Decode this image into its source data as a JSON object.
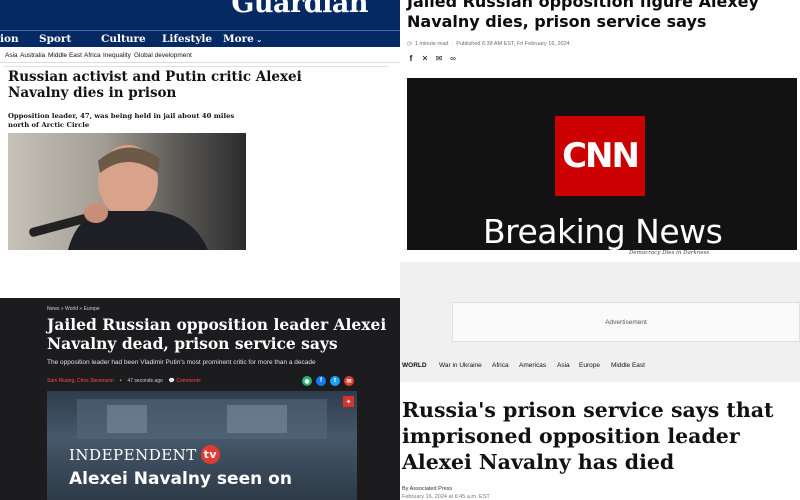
{
  "guardian": {
    "logo": "Guardian",
    "nav": [
      "ion",
      "Sport",
      "Culture",
      "Lifestyle",
      "More"
    ],
    "subnav": [
      "Asia",
      "Australia",
      "Middle East",
      "Africa",
      "Inequality",
      "Global development"
    ],
    "headline": "Russian activist and Putin critic Alexei Navalny dies in prison",
    "standfirst": "Opposition leader, 47, was being held in jail about 40 miles north of Arctic Circle",
    "colors": {
      "brand": "#052962"
    }
  },
  "cnn": {
    "headline": "Jailed Russian opposition figure Alexey Navalny dies, prison service says",
    "read_time": "1 minute read",
    "published": "Published 6:39 AM EST, Fri February 16, 2024",
    "share_icons": [
      "facebook-icon",
      "x-icon",
      "email-icon",
      "link-icon"
    ],
    "logo": "CNN",
    "breaking": "Breaking News",
    "tagline": "Democracy Dies in Darkness",
    "colors": {
      "brand": "#cc0000"
    }
  },
  "independent": {
    "breadcrumb": "News » World » Europe",
    "headline": "Jailed Russian opposition leader Alexei Navalny dead, prison service says",
    "standfirst": "The opposition leader had been Vladimir Putin's most prominent critic for more than a decade",
    "authors": "Sam Rkaing, Chris Stevenson",
    "time_ago": "47 seconds ago",
    "comments": "Comments",
    "brand": "INDEPENDENT",
    "brand_tv": "tv",
    "video_caption": "Alexei Navalny seen on",
    "colors": {
      "accent": "#e03c31"
    }
  },
  "wapo": {
    "ad_label": "Advertisement",
    "nav": [
      "WORLD",
      "War in Ukraine",
      "Africa",
      "Americas",
      "Asia",
      "Europe",
      "Middle East"
    ],
    "headline": "Russia's prison service says that imprisoned opposition leader Alexei Navalny has died",
    "byline": "By Associated Press",
    "date": "February 16, 2024 at 6:45 a.m. EST"
  }
}
